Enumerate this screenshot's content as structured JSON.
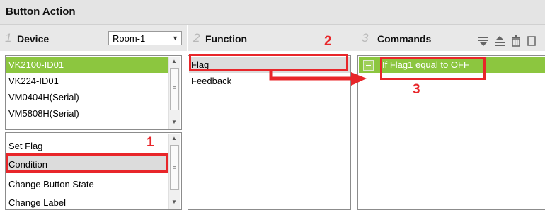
{
  "window": {
    "title": "Button Action"
  },
  "device_panel": {
    "step": "1",
    "title": "Device",
    "room_select": {
      "value": "Room-1"
    },
    "devices": [
      "VK2100-ID01",
      "VK224-ID01",
      "VM0404H(Serial)",
      "VM5808H(Serial)"
    ],
    "actions": [
      "Set Flag",
      "Condition",
      "Change Button State",
      "Change Label"
    ]
  },
  "function_panel": {
    "step": "2",
    "title": "Function",
    "items": [
      "Flag",
      "Feedback"
    ]
  },
  "commands_panel": {
    "step": "3",
    "title": "Commands",
    "toolbar_icons": [
      "move-down-icon",
      "move-up-icon",
      "delete-icon"
    ],
    "items": [
      "If Flag1 equal to OFF"
    ]
  },
  "annotations": {
    "marker_1": "1",
    "marker_2": "2",
    "marker_3": "3"
  },
  "colors": {
    "accent_green": "#8cc63f",
    "annotation_red": "#e8262a",
    "selected_gray": "#dcdcdc"
  }
}
